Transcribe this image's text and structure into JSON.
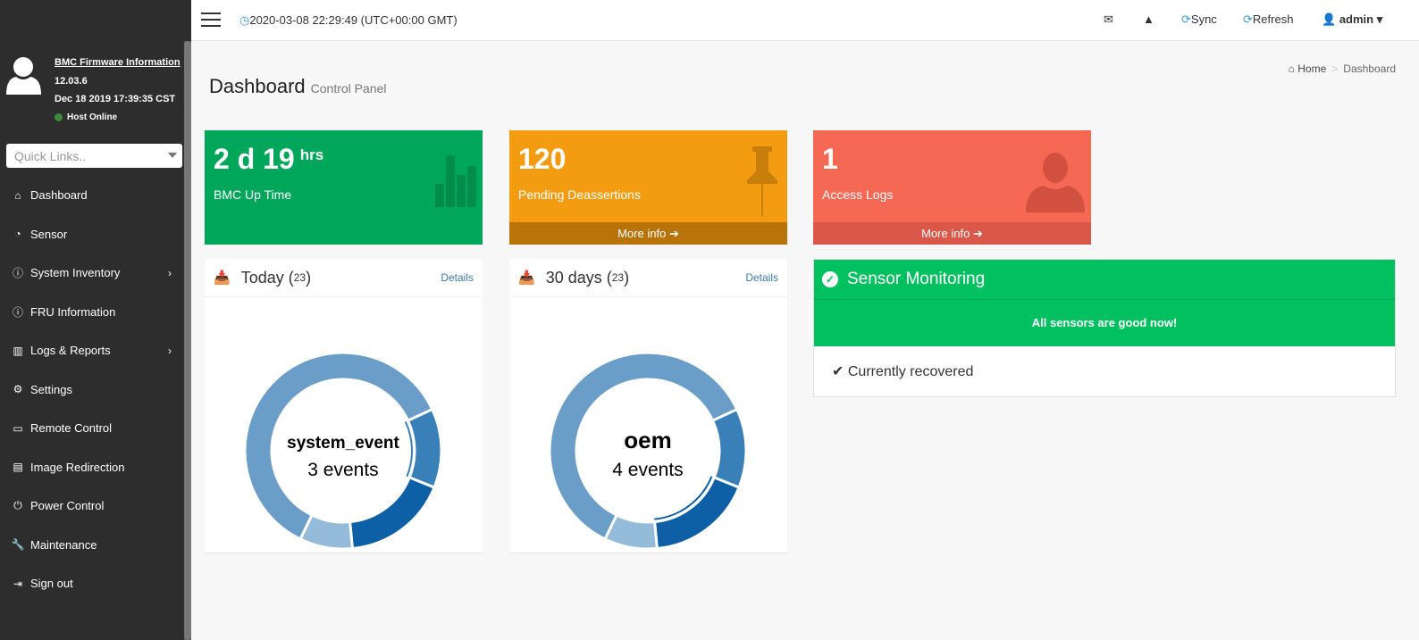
{
  "topbar": {
    "datetime": "2020-03-08 22:29:49 (UTC+00:00 GMT)",
    "sync": "Sync",
    "refresh": "Refresh",
    "user": "admin"
  },
  "sidebar": {
    "firmware_link": "BMC Firmware Information",
    "version": "12.03.6",
    "build_date": "Dec 18 2019 17:39:35 CST",
    "host_status": "Host Online",
    "quick_links_placeholder": "Quick Links..",
    "items": [
      {
        "label": "Dashboard",
        "icon": "home-icon"
      },
      {
        "label": "Sensor",
        "icon": "gauge-icon"
      },
      {
        "label": "System Inventory",
        "icon": "info-icon",
        "submenu": true
      },
      {
        "label": "FRU Information",
        "icon": "info-icon"
      },
      {
        "label": "Logs & Reports",
        "icon": "bar-chart-icon",
        "submenu": true
      },
      {
        "label": "Settings",
        "icon": "gear-icon"
      },
      {
        "label": "Remote Control",
        "icon": "monitor-icon"
      },
      {
        "label": "Image Redirection",
        "icon": "drive-icon"
      },
      {
        "label": "Power Control",
        "icon": "power-icon"
      },
      {
        "label": "Maintenance",
        "icon": "wrench-icon"
      },
      {
        "label": "Sign out",
        "icon": "sign-out-icon"
      }
    ]
  },
  "header": {
    "title": "Dashboard",
    "subtitle": "Control Panel",
    "breadcrumb": [
      "Home",
      "Dashboard"
    ]
  },
  "boxes": [
    {
      "value": "2 d 19",
      "unit": "hrs",
      "label": "BMC Up Time",
      "color": "#00a65a"
    },
    {
      "value": "120",
      "label": "Pending Deassertions",
      "more": "More info",
      "color": "#f39c12"
    },
    {
      "value": "1",
      "label": "Access Logs",
      "more": "More info",
      "color": "#f56954"
    }
  ],
  "panels": [
    {
      "title": "Today",
      "count": "23",
      "details": "Details",
      "center_name": "system_event",
      "center_value": "3 events",
      "highlight": 0
    },
    {
      "title": "30 days",
      "count": "23",
      "details": "Details",
      "center_name": "oem",
      "center_value": "4 events",
      "highlight": 1
    }
  ],
  "chart_data": [
    {
      "type": "pie",
      "title": "Today",
      "total": 23,
      "values": [
        3,
        4,
        2,
        14
      ],
      "colors": [
        "#3a80b8",
        "#0d5fa6",
        "#94bbd9",
        "#6a9ec9"
      ]
    },
    {
      "type": "pie",
      "title": "30 days",
      "total": 23,
      "values": [
        3,
        4,
        2,
        14
      ],
      "colors": [
        "#3a80b8",
        "#0d5fa6",
        "#94bbd9",
        "#6a9ec9"
      ]
    }
  ],
  "sensor": {
    "title": "Sensor Monitoring",
    "status": "All sensors are good now!",
    "recovered": "Currently recovered"
  }
}
